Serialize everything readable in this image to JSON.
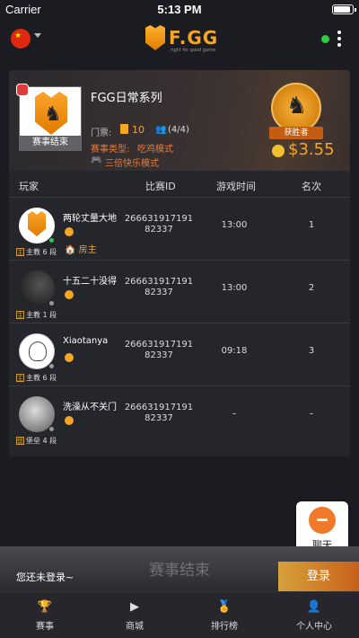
{
  "status": {
    "carrier": "Carrier",
    "time": "5:13 PM"
  },
  "header": {
    "logo_text": "F.GG",
    "logo_sub": "right for good game"
  },
  "match": {
    "thumb_ended": "赛事结束",
    "name": "FGG日常系列",
    "ticket_label": "门票:",
    "ticket_value": "10",
    "players_value": "(4/4)",
    "type_label": "赛事类型:",
    "type_value": "吃鸡模式",
    "mode_value": "三倍快乐模式",
    "winner_label": "获胜者",
    "prize": "$3.55"
  },
  "table": {
    "headers": [
      "玩家",
      "比赛ID",
      "游戏时间",
      "名次"
    ],
    "rows": [
      {
        "name": "两轮丈量大地",
        "rank": "主教 6 段",
        "rank_icon": "主",
        "match_id": "26663191719182337",
        "time": "13:00",
        "place": "1",
        "host": "房主"
      },
      {
        "name": "十五二十没得",
        "rank": "主教 1 段",
        "rank_icon": "主",
        "match_id": "26663191719182337",
        "time": "13:00",
        "place": "2"
      },
      {
        "name": "Xiaotanya",
        "rank": "主教 6 段",
        "rank_icon": "主",
        "match_id": "26663191719182337",
        "time": "09:18",
        "place": "3"
      },
      {
        "name": "洗澡从不关门",
        "rank": "堡垒 4 段",
        "rank_icon": "堡",
        "match_id": "26663191719182337",
        "time": "–",
        "place": "–"
      }
    ]
  },
  "chat": {
    "label": "聊天"
  },
  "login": {
    "overlay": "赛事结束",
    "prompt": "您还未登录~",
    "button": "登录"
  },
  "tabs": [
    {
      "label": "赛事",
      "icon": "trophy-icon"
    },
    {
      "label": "商城",
      "icon": "video-icon"
    },
    {
      "label": "排行榜",
      "icon": "ranking-icon"
    },
    {
      "label": "个人中心",
      "icon": "user-icon"
    }
  ],
  "colors": {
    "accent": "#f5a623",
    "highlight": "#e87b3a",
    "online": "#2ecc40"
  }
}
